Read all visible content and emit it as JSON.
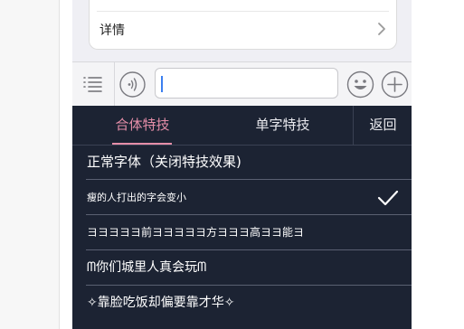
{
  "details_card": {
    "label": "详情"
  },
  "chat_input": {
    "value": "",
    "placeholder": ""
  },
  "font_panel": {
    "tabs": [
      {
        "label": "合体特技",
        "active": true
      },
      {
        "label": "单字特技",
        "active": false
      },
      {
        "label": "返回",
        "active": false
      }
    ],
    "items": [
      {
        "text": "正常字体（关闭特技效果)",
        "selected": false
      },
      {
        "text": "瘦的人打出的字会变小",
        "selected": true
      },
      {
        "text": "ヨヨヨヨヨ前ヨヨヨヨヨ方ヨヨヨ高ヨヨ能ヨ",
        "selected": false
      },
      {
        "text": "ᗰ你们城里人真会玩ᗰ",
        "selected": false
      },
      {
        "text": "✧靠脸吃饭却偏要靠才华✧",
        "selected": false
      }
    ]
  },
  "colors": {
    "panel_bg": "#1c2333",
    "active_tab": "#e58ea8",
    "caret": "#3c7ff0"
  },
  "icons": [
    "chevron-right-icon",
    "list-menu-icon",
    "voice-icon",
    "emoji-icon",
    "plus-icon",
    "checkmark-icon"
  ]
}
